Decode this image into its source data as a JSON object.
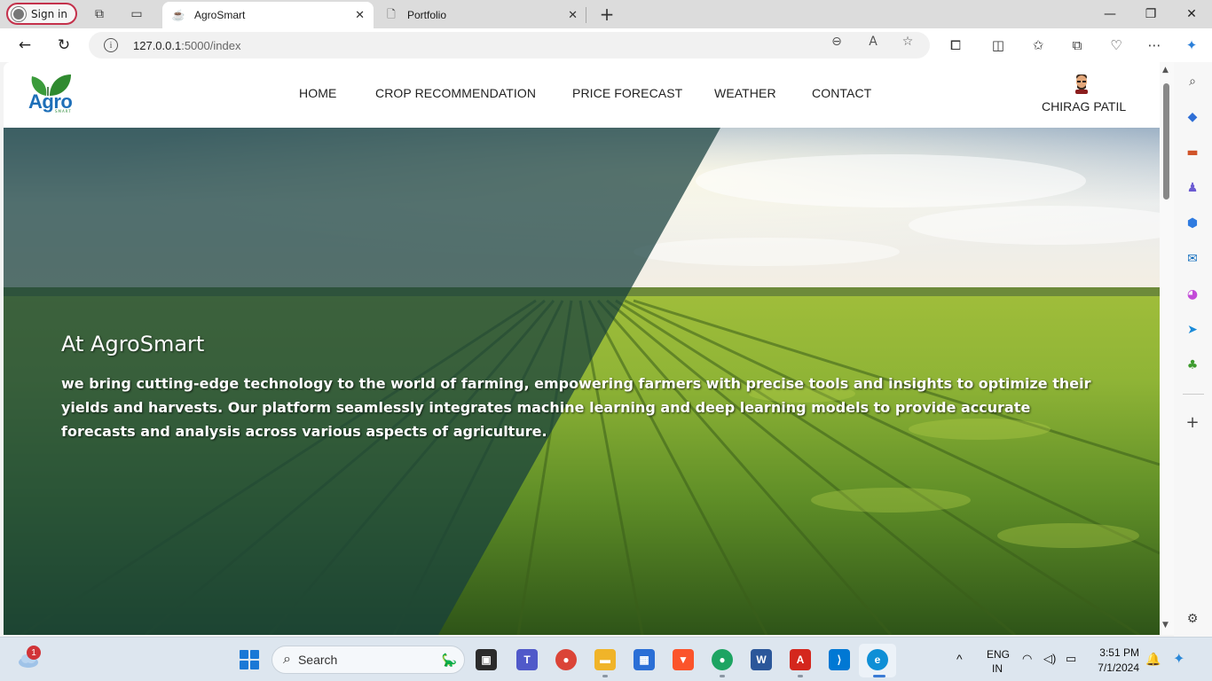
{
  "browser": {
    "signin_label": "Sign in",
    "tabs": [
      {
        "title": "AgroSmart",
        "active": true
      },
      {
        "title": "Portfolio",
        "active": false
      }
    ],
    "url_host": "127.0.0.1",
    "url_path": ":5000/index"
  },
  "site": {
    "logo_text": "Agro",
    "logo_subtext": "SMART",
    "nav": [
      "HOME",
      "CROP RECOMMENDATION",
      "PRICE FORECAST",
      "WEATHER",
      "CONTACT"
    ],
    "user_name": "CHIRAG PATIL",
    "hero_title": "At AgroSmart",
    "hero_text": "we bring cutting-edge technology to the world of farming, empowering farmers with precise tools and insights to optimize their yields and harvests. Our platform seamlessly integrates machine learning and deep learning models to provide accurate forecasts and analysis across various aspects of agriculture."
  },
  "taskbar": {
    "notification_count": "1",
    "search_placeholder": "Search",
    "language": "ENG",
    "region": "IN",
    "time": "3:51 PM",
    "date": "7/1/2024"
  },
  "colors": {
    "accent": "#1e6fb8",
    "signin_border": "#c4314b",
    "overlay": "#1e4a45"
  }
}
